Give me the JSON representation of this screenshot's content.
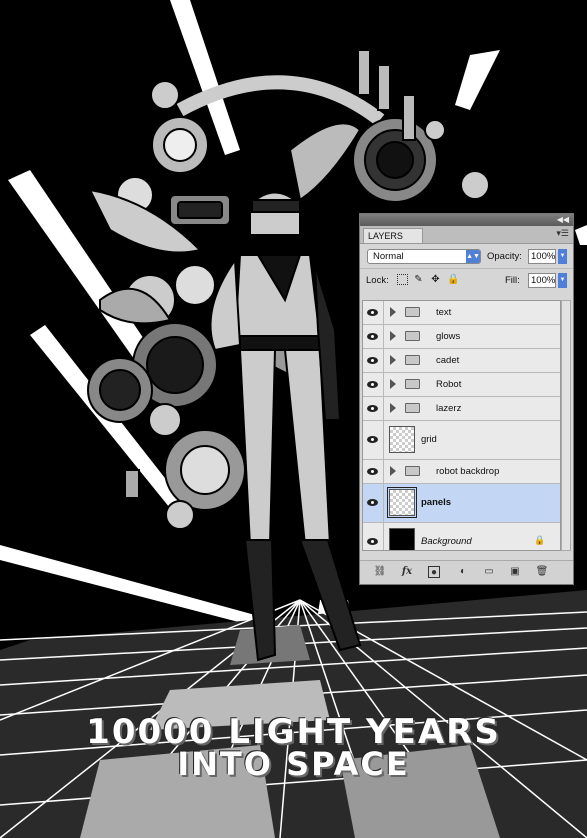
{
  "poster": {
    "title_line1": "10000 LIGHT YEARS",
    "title_line2": "INTO SPACE"
  },
  "layers_panel": {
    "tab_label": "LAYERS",
    "blend_mode": "Normal",
    "opacity_label": "Opacity:",
    "opacity_value": "100%",
    "lock_label": "Lock:",
    "fill_label": "Fill:",
    "fill_value": "100%",
    "layers": [
      {
        "name": "text",
        "kind": "group"
      },
      {
        "name": "glows",
        "kind": "group"
      },
      {
        "name": "cadet",
        "kind": "group"
      },
      {
        "name": "Robot",
        "kind": "group"
      },
      {
        "name": "lazerz",
        "kind": "group"
      },
      {
        "name": "grid",
        "kind": "layer"
      },
      {
        "name": "robot backdrop",
        "kind": "group"
      },
      {
        "name": "panels",
        "kind": "layer",
        "selected": true
      },
      {
        "name": "Background",
        "kind": "background",
        "locked": true
      }
    ],
    "footer_icons": [
      "link-icon",
      "fx-icon",
      "mask-icon",
      "adjustment-icon",
      "folder-icon",
      "new-layer-icon",
      "trash-icon"
    ],
    "accent_color": "#4f7fd6",
    "selected_row_color": "#c3d7f4"
  }
}
